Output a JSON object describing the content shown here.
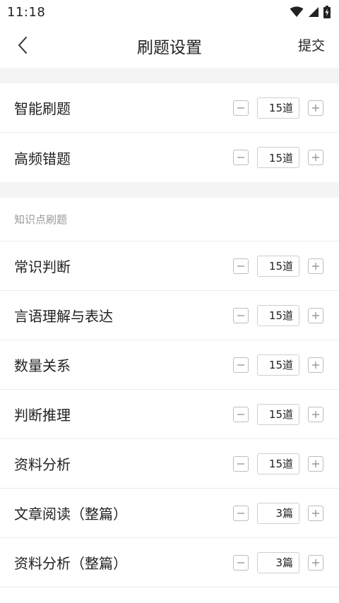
{
  "status_bar": {
    "time": "11:18"
  },
  "nav": {
    "title": "刷题设置",
    "submit_label": "提交"
  },
  "group1": [
    {
      "label": "智能刷题",
      "value": "15道"
    },
    {
      "label": "高频错题",
      "value": "15道"
    }
  ],
  "section_header": "知识点刷题",
  "group2": [
    {
      "label": "常识判断",
      "value": "15道"
    },
    {
      "label": "言语理解与表达",
      "value": "15道"
    },
    {
      "label": "数量关系",
      "value": "15道"
    },
    {
      "label": "判断推理",
      "value": "15道"
    },
    {
      "label": "资料分析",
      "value": "15道"
    },
    {
      "label": "文章阅读（整篇）",
      "value": "3篇"
    },
    {
      "label": "资料分析（整篇）",
      "value": "3篇"
    }
  ]
}
